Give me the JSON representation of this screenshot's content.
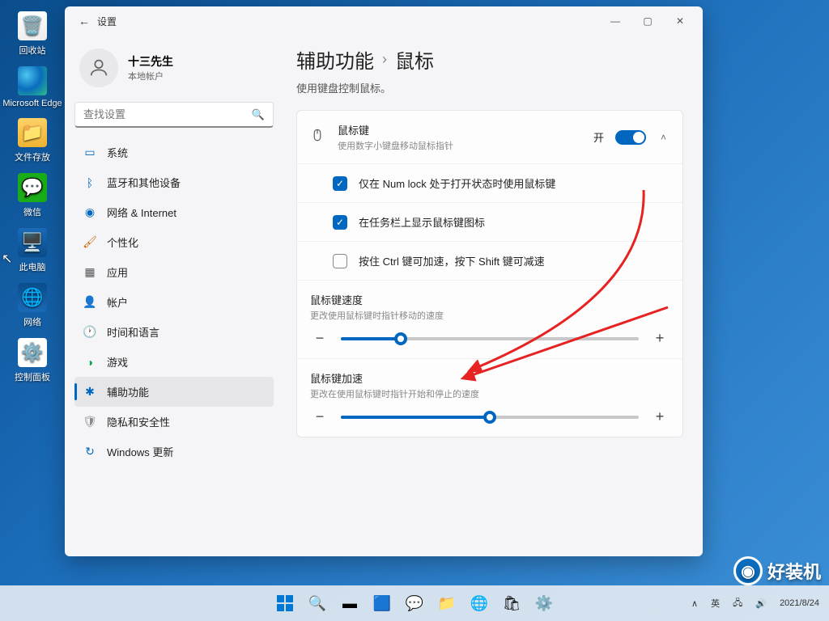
{
  "desktop": {
    "icons": [
      {
        "label": "回收站"
      },
      {
        "label": "Microsoft Edge"
      },
      {
        "label": "文件存放"
      },
      {
        "label": "微信"
      },
      {
        "label": "此电脑"
      },
      {
        "label": "网络"
      },
      {
        "label": "控制面板"
      }
    ]
  },
  "window": {
    "title": "设置"
  },
  "user": {
    "name": "十三先生",
    "account_type": "本地帐户"
  },
  "search": {
    "placeholder": "查找设置"
  },
  "nav": {
    "items": [
      {
        "label": "系统",
        "icon_color": "#0067c0"
      },
      {
        "label": "蓝牙和其他设备",
        "icon_color": "#0067c0"
      },
      {
        "label": "网络 & Internet",
        "icon_color": "#0067c0"
      },
      {
        "label": "个性化",
        "icon_color": "#c96209"
      },
      {
        "label": "应用",
        "icon_color": "#555"
      },
      {
        "label": "帐户",
        "icon_color": "#555"
      },
      {
        "label": "时间和语言",
        "icon_color": "#555"
      },
      {
        "label": "游戏",
        "icon_color": "#09a854"
      },
      {
        "label": "辅助功能",
        "icon_color": "#0067c0",
        "active": true
      },
      {
        "label": "隐私和安全性",
        "icon_color": "#888"
      },
      {
        "label": "Windows 更新",
        "icon_color": "#0067c0"
      }
    ]
  },
  "breadcrumb": {
    "parent": "辅助功能",
    "current": "鼠标"
  },
  "subtitle": "使用键盘控制鼠标。",
  "mouse_keys": {
    "title": "鼠标键",
    "description": "使用数字小键盘移动鼠标指针",
    "state_label": "开",
    "state_on": true,
    "options": [
      {
        "label": "仅在 Num lock 处于打开状态时使用鼠标键",
        "checked": true
      },
      {
        "label": "在任务栏上显示鼠标键图标",
        "checked": true
      },
      {
        "label": "按住 Ctrl 键可加速，按下 Shift 键可减速",
        "checked": false
      }
    ],
    "speed": {
      "title": "鼠标键速度",
      "description": "更改使用鼠标键时指针移动的速度",
      "value_percent": 20
    },
    "accel": {
      "title": "鼠标键加速",
      "description": "更改在使用鼠标键时指针开始和停止的速度",
      "value_percent": 50
    }
  },
  "taskbar": {
    "ime": "英",
    "date": "2021/8/24",
    "chevron": "∧"
  },
  "watermark": "好装机"
}
